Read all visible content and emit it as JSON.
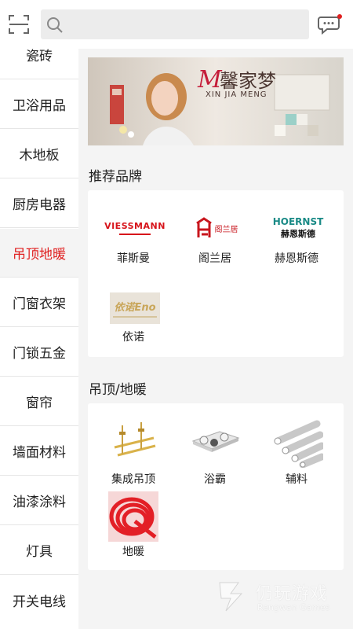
{
  "search": {
    "placeholder": ""
  },
  "sidebar": {
    "items": [
      {
        "label": "瓷砖"
      },
      {
        "label": "卫浴用品"
      },
      {
        "label": "木地板"
      },
      {
        "label": "厨房电器"
      },
      {
        "label": "吊顶地暖"
      },
      {
        "label": "门窗衣架"
      },
      {
        "label": "门锁五金"
      },
      {
        "label": "窗帘"
      },
      {
        "label": "墙面材料"
      },
      {
        "label": "油漆涂料"
      },
      {
        "label": "灯具"
      },
      {
        "label": "开关电线"
      }
    ],
    "active_index": 4
  },
  "banner": {
    "brand": "馨家梦",
    "brand_pinyin": "XIN JIA MENG"
  },
  "brands": {
    "title": "推荐品牌",
    "items": [
      {
        "name": "菲斯曼",
        "logo_text": "VIESSMANN"
      },
      {
        "name": "阁兰居",
        "logo_text": "阁兰居"
      },
      {
        "name": "赫恩斯德",
        "logo_text": "HOERNST",
        "logo_subtext": "赫恩斯德"
      },
      {
        "name": "依诺",
        "logo_text": "依诺Eno"
      }
    ]
  },
  "category": {
    "title": "吊顶/地暖",
    "items": [
      {
        "name": "集成吊顶",
        "icon": "ceiling-frame-icon"
      },
      {
        "name": "浴霸",
        "icon": "bath-heater-icon"
      },
      {
        "name": "辅料",
        "icon": "pipes-icon"
      },
      {
        "name": "地暖",
        "icon": "heating-pipe-icon"
      }
    ]
  },
  "watermark": {
    "main": "仍玩游戏",
    "sub": "Rengwan Games"
  },
  "colors": {
    "accent": "#e02020",
    "background": "#f4f4f4",
    "card": "#ffffff"
  }
}
